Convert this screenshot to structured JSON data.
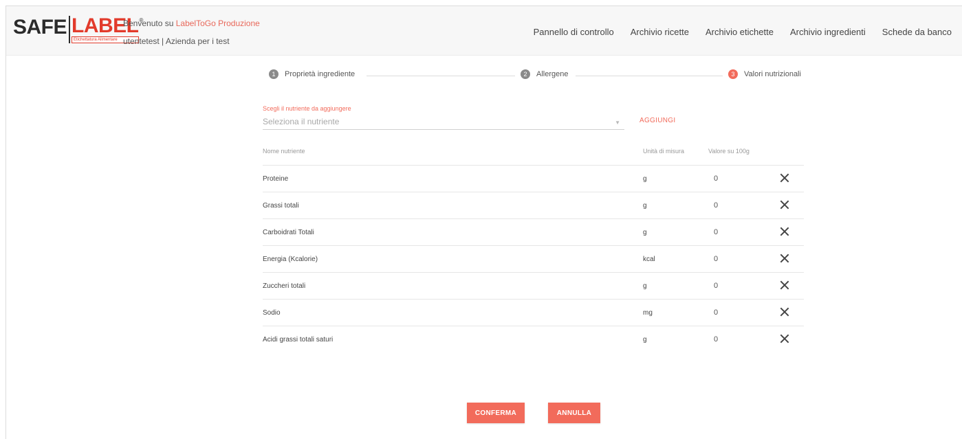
{
  "header": {
    "logo": {
      "word_left": "SAFE",
      "word_right": "LABEL",
      "tagline": "Etichettatura Alimentare",
      "reg": "®"
    },
    "welcome_prefix": "Benvenuto su ",
    "welcome_brand": "LabelToGo Produzione",
    "user_line": "utentetest | Azienda per i test",
    "nav": [
      {
        "label": "Pannello di controllo"
      },
      {
        "label": "Archivio ricette"
      },
      {
        "label": "Archivio etichette"
      },
      {
        "label": "Archivio ingredienti"
      },
      {
        "label": "Schede da banco"
      }
    ]
  },
  "stepper": {
    "steps": [
      {
        "number": "1",
        "label": "Proprietà ingrediente",
        "active": false
      },
      {
        "number": "2",
        "label": "Allergene",
        "active": false
      },
      {
        "number": "3",
        "label": "Valori nutrizionali",
        "active": true
      }
    ]
  },
  "picker": {
    "label": "Scegli il nutriente da aggiungere",
    "placeholder": "Seleziona il nutriente",
    "add_label": "AGGIUNGI"
  },
  "table": {
    "headers": {
      "name": "Nome nutriente",
      "unit": "Unità di misura",
      "value": "Valore su 100g"
    },
    "rows": [
      {
        "name": "Proteine",
        "unit": "g",
        "value": "0"
      },
      {
        "name": "Grassi totali",
        "unit": "g",
        "value": "0"
      },
      {
        "name": "Carboidrati Totali",
        "unit": "g",
        "value": "0"
      },
      {
        "name": "Energia (Kcalorie)",
        "unit": "kcal",
        "value": "0"
      },
      {
        "name": "Zuccheri totali",
        "unit": "g",
        "value": "0"
      },
      {
        "name": "Sodio",
        "unit": "mg",
        "value": "0"
      },
      {
        "name": "Acidi grassi totali saturi",
        "unit": "g",
        "value": "0"
      }
    ]
  },
  "actions": {
    "confirm_label": "CONFERMA",
    "cancel_label": "ANNULLA"
  },
  "colors": {
    "accent": "#f26b5b",
    "brand_red": "#e23b2c",
    "step_inactive": "#8a8a8a"
  }
}
